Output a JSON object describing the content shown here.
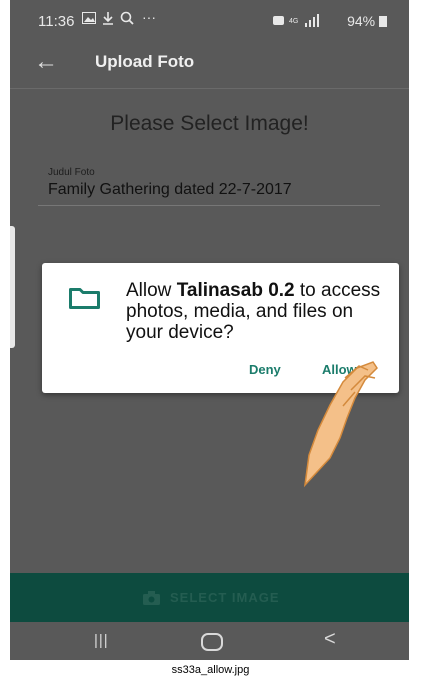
{
  "status_bar": {
    "time": "11:36",
    "left_icons": [
      "image-icon",
      "download-icon",
      "search-icon",
      "more-icon"
    ],
    "right_text": "94%"
  },
  "app_bar": {
    "title": "Upload Foto"
  },
  "main": {
    "heading": "Please Select Image!",
    "field_label": "Judul Foto",
    "field_value": "Family Gathering dated 22-7-2017"
  },
  "dialog": {
    "text_before": "Allow ",
    "app_name": "Talinasab 0.2",
    "text_after": " to access photos, media, and files on your device?",
    "deny_label": "Deny",
    "allow_label": "Allow",
    "accent_color": "#1b7c6b"
  },
  "select_button": {
    "label": "SELECT IMAGE"
  },
  "nav_bar": {
    "recent_glyph": "|||",
    "back_glyph": "<"
  },
  "caption": "ss33a_allow.jpg"
}
